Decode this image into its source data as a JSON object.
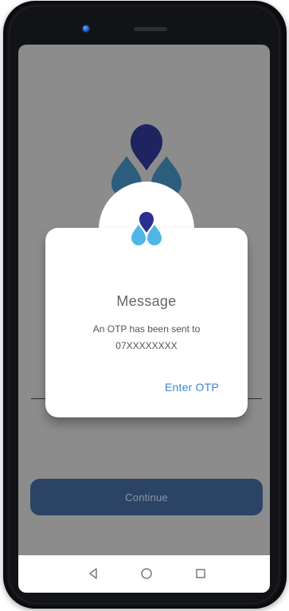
{
  "dialog": {
    "title": "Message",
    "message_line_1": "An OTP has been sent to",
    "message_line_2": "07XXXXXXXX",
    "action_label": "Enter OTP"
  },
  "form": {
    "continue_label": "Continue"
  },
  "navigation": {
    "back_icon": "back-triangle-icon",
    "home_icon": "home-circle-icon",
    "recents_icon": "recents-square-icon"
  },
  "colors": {
    "screen_overlay": "#8C8C8C",
    "dialog_background": "#FFFFFF",
    "dialog_title": "#666666",
    "dialog_text": "#555555",
    "action": "#3C86C8",
    "continue_button": "#2B4466",
    "continue_text": "#8A96A8",
    "logo_dark": "#1D2460",
    "logo_teal": "#2C5D7D",
    "logo_light": "#4FB7E8",
    "nav_icon": "#7A7A7A"
  }
}
